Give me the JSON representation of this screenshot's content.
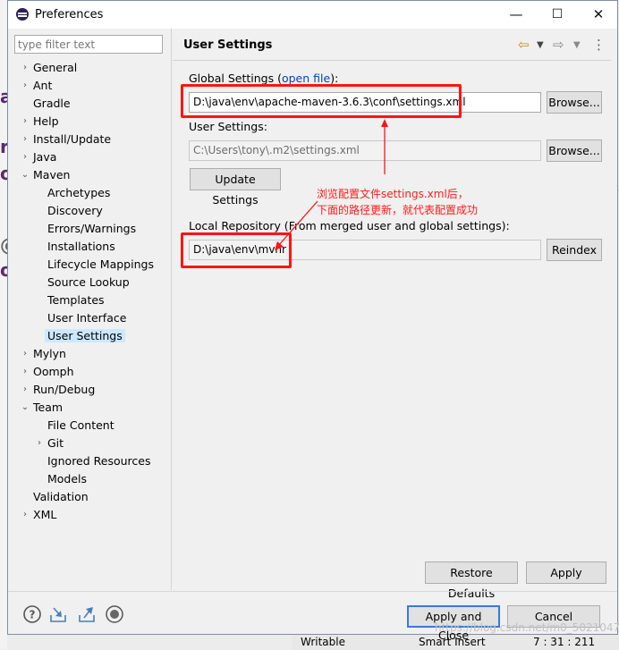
{
  "window": {
    "title": "Preferences",
    "controls": [
      "—",
      "☐",
      "✕"
    ]
  },
  "filter": {
    "placeholder": "type filter text",
    "value": ""
  },
  "tree": {
    "items": [
      {
        "label": "General",
        "expander": "›"
      },
      {
        "label": "Ant",
        "expander": "›"
      },
      {
        "label": "Gradle",
        "expander": ""
      },
      {
        "label": "Help",
        "expander": "›"
      },
      {
        "label": "Install/Update",
        "expander": "›"
      },
      {
        "label": "Java",
        "expander": "›"
      },
      {
        "label": "Maven",
        "expander": "⌄"
      },
      {
        "label": "Archetypes",
        "expander": ""
      },
      {
        "label": "Discovery",
        "expander": ""
      },
      {
        "label": "Errors/Warnings",
        "expander": ""
      },
      {
        "label": "Installations",
        "expander": ""
      },
      {
        "label": "Lifecycle Mappings",
        "expander": ""
      },
      {
        "label": "Source Lookup",
        "expander": ""
      },
      {
        "label": "Templates",
        "expander": ""
      },
      {
        "label": "User Interface",
        "expander": ""
      },
      {
        "label": "User Settings",
        "expander": ""
      },
      {
        "label": "Mylyn",
        "expander": "›"
      },
      {
        "label": "Oomph",
        "expander": "›"
      },
      {
        "label": "Run/Debug",
        "expander": "›"
      },
      {
        "label": "Team",
        "expander": "⌄"
      },
      {
        "label": "File Content",
        "expander": ""
      },
      {
        "label": "Git",
        "expander": "›"
      },
      {
        "label": "Ignored Resources",
        "expander": ""
      },
      {
        "label": "Models",
        "expander": ""
      },
      {
        "label": "Validation",
        "expander": ""
      },
      {
        "label": "XML",
        "expander": "›"
      }
    ],
    "selected": "User Settings"
  },
  "panel": {
    "title": "User Settings",
    "global_label_prefix": "Global Settings (",
    "global_label_link": "open file",
    "global_label_suffix": "):",
    "global_value": "D:\\java\\env\\apache-maven-3.6.3\\conf\\settings.xml",
    "user_label": "User Settings:",
    "user_value": "C:\\Users\\tony\\.m2\\settings.xml",
    "browse_label": "Browse...",
    "update_label": "Update Settings",
    "local_repo_label": "Local Repository (From merged user and global settings):",
    "local_repo_value": "D:\\java\\env\\mvnr",
    "reindex_label": "Reindex",
    "restore_defaults_label": "Restore Defaults",
    "apply_label": "Apply"
  },
  "annotation": {
    "line1": "浏览配置文件settings.xml后，",
    "line2": "下面的路径更新，就代表配置成功",
    "color": "#ff1414"
  },
  "footer": {
    "apply_close_label": "Apply and Close",
    "cancel_label": "Cancel",
    "icons": [
      "help-icon",
      "import-icon",
      "export-icon",
      "record-icon"
    ]
  },
  "background": {
    "status_writable": "Writable",
    "status_insert": "Smart Insert",
    "status_position": "7 : 31 : 211",
    "watermark": "https://blog.csdn.net/m0_50210478"
  }
}
